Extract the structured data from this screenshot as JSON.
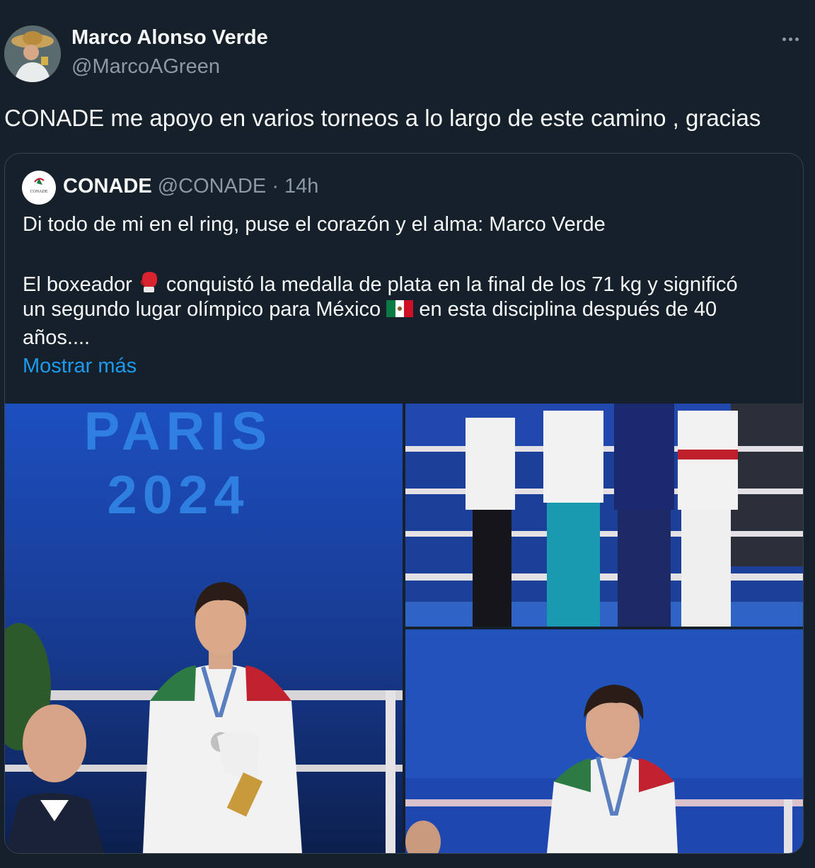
{
  "author": {
    "name": "Marco Alonso Verde",
    "handle": "@MarcoAGreen",
    "avatar_icon": "user-avatar"
  },
  "tweet": {
    "text": "CONADE me apoyo en varios torneos a lo largo de este camino , gracias"
  },
  "quoted": {
    "name": "CONADE",
    "handle": "@CONADE",
    "separator": "·",
    "time": "14h",
    "avatar_text": "CONADE",
    "line1": "Di todo de mi en el ring, puse el corazón y el alma: Marco Verde",
    "line2_a": "El boxeador",
    "line2_b": "conquistó la medalla de plata en la final de los 71 kg y significó",
    "line3_a": "un segundo lugar olímpico para México",
    "line3_b": "en esta disciplina después de 40",
    "line4": "años....",
    "show_more": "Mostrar más"
  },
  "photos": [
    {
      "name": "photo-paris-2024-medalist",
      "banner_line1": "PARIS",
      "banner_line2": "2024"
    },
    {
      "name": "photo-podium"
    },
    {
      "name": "photo-closeup"
    }
  ],
  "colors": {
    "background": "#15202b",
    "text": "#f7f9f9",
    "muted": "#8b98a5",
    "link": "#1d9bf0",
    "border": "#38444d"
  }
}
